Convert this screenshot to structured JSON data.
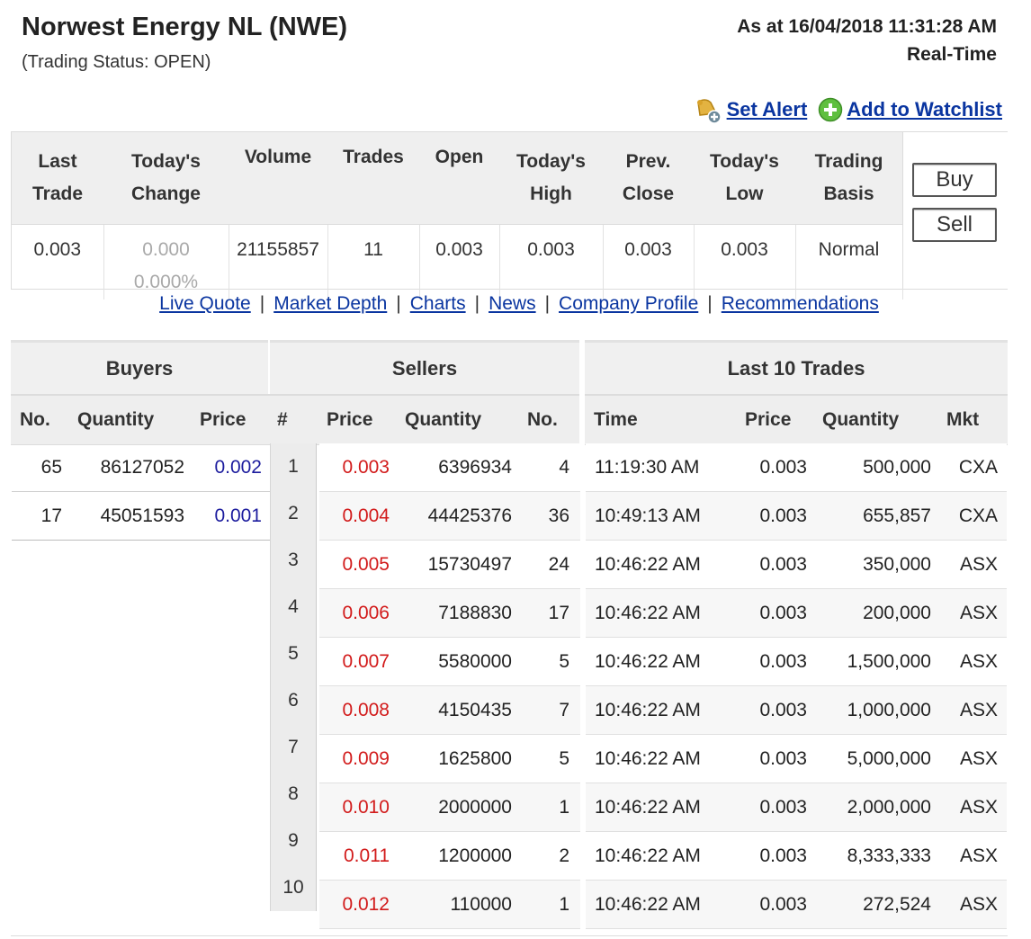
{
  "header": {
    "title": "Norwest Energy NL (NWE)",
    "status": "(Trading Status: OPEN)",
    "as_at": "As at 16/04/2018 11:31:28 AM",
    "mode": "Real-Time"
  },
  "actions": {
    "set_alert": "Set Alert",
    "add_watchlist": "Add to Watchlist"
  },
  "quote": {
    "headers": {
      "last_trade": [
        "Last",
        "Trade"
      ],
      "todays_change": [
        "Today's",
        "Change"
      ],
      "volume": "Volume",
      "trades": "Trades",
      "open": "Open",
      "todays_high": [
        "Today's",
        "High"
      ],
      "prev_close": [
        "Prev.",
        "Close"
      ],
      "todays_low": [
        "Today's",
        "Low"
      ],
      "trading_basis": [
        "Trading",
        "Basis"
      ]
    },
    "values": {
      "last_trade": "0.003",
      "change": "0.000",
      "change_pct": "0.000%",
      "volume": "21155857",
      "trades": "11",
      "open": "0.003",
      "high": "0.003",
      "prev_close": "0.003",
      "low": "0.003",
      "basis": "Normal"
    },
    "buy_label": "Buy",
    "sell_label": "Sell"
  },
  "nav": [
    "Live Quote",
    "Market Depth",
    "Charts",
    "News",
    "Company Profile",
    "Recommendations"
  ],
  "depth": {
    "buyers_title": "Buyers",
    "sellers_title": "Sellers",
    "buy_headers": {
      "no": "No.",
      "quantity": "Quantity",
      "price": "Price",
      "hash": "#"
    },
    "sell_headers": {
      "price": "Price",
      "quantity": "Quantity",
      "no": "No."
    },
    "buyers": [
      {
        "no": "65",
        "quantity": "86127052",
        "price": "0.002"
      },
      {
        "no": "17",
        "quantity": "45051593",
        "price": "0.001"
      }
    ],
    "levels": [
      "1",
      "2",
      "3",
      "4",
      "5",
      "6",
      "7",
      "8",
      "9",
      "10"
    ],
    "sellers": [
      {
        "price": "0.003",
        "quantity": "6396934",
        "no": "4"
      },
      {
        "price": "0.004",
        "quantity": "44425376",
        "no": "36"
      },
      {
        "price": "0.005",
        "quantity": "15730497",
        "no": "24"
      },
      {
        "price": "0.006",
        "quantity": "7188830",
        "no": "17"
      },
      {
        "price": "0.007",
        "quantity": "5580000",
        "no": "5"
      },
      {
        "price": "0.008",
        "quantity": "4150435",
        "no": "7"
      },
      {
        "price": "0.009",
        "quantity": "1625800",
        "no": "5"
      },
      {
        "price": "0.010",
        "quantity": "2000000",
        "no": "1"
      },
      {
        "price": "0.011",
        "quantity": "1200000",
        "no": "2"
      },
      {
        "price": "0.012",
        "quantity": "110000",
        "no": "1"
      }
    ]
  },
  "trades": {
    "title": "Last 10 Trades",
    "headers": {
      "time": "Time",
      "price": "Price",
      "quantity": "Quantity",
      "mkt": "Mkt"
    },
    "rows": [
      {
        "time": "11:19:30 AM",
        "price": "0.003",
        "quantity": "500,000",
        "mkt": "CXA"
      },
      {
        "time": "10:49:13 AM",
        "price": "0.003",
        "quantity": "655,857",
        "mkt": "CXA"
      },
      {
        "time": "10:46:22 AM",
        "price": "0.003",
        "quantity": "350,000",
        "mkt": "ASX"
      },
      {
        "time": "10:46:22 AM",
        "price": "0.003",
        "quantity": "200,000",
        "mkt": "ASX"
      },
      {
        "time": "10:46:22 AM",
        "price": "0.003",
        "quantity": "1,500,000",
        "mkt": "ASX"
      },
      {
        "time": "10:46:22 AM",
        "price": "0.003",
        "quantity": "1,000,000",
        "mkt": "ASX"
      },
      {
        "time": "10:46:22 AM",
        "price": "0.003",
        "quantity": "5,000,000",
        "mkt": "ASX"
      },
      {
        "time": "10:46:22 AM",
        "price": "0.003",
        "quantity": "2,000,000",
        "mkt": "ASX"
      },
      {
        "time": "10:46:22 AM",
        "price": "0.003",
        "quantity": "8,333,333",
        "mkt": "ASX"
      },
      {
        "time": "10:46:22 AM",
        "price": "0.003",
        "quantity": "272,524",
        "mkt": "ASX"
      }
    ]
  },
  "colors": {
    "ask_price": "#d21b1b",
    "bid_price": "#1c1c9e",
    "link": "#0a35a0"
  }
}
